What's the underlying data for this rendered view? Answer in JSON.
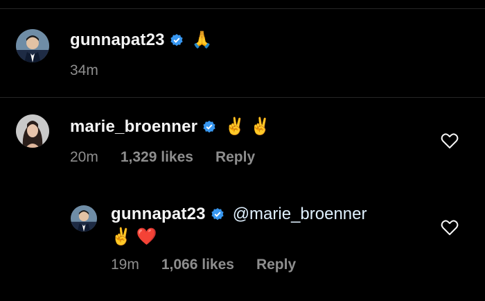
{
  "comments": [
    {
      "username": "gunnapat23",
      "verified": true,
      "emoji": "🙏",
      "time": "34m"
    },
    {
      "username": "marie_broenner",
      "verified": true,
      "emoji": "✌️ ✌️",
      "time": "20m",
      "likes": "1,329 likes",
      "reply_label": "Reply"
    },
    {
      "username": "gunnapat23",
      "verified": true,
      "mention": "@marie_broenner",
      "emoji": "✌️ ❤️",
      "time": "19m",
      "likes": "1,066 likes",
      "reply_label": "Reply"
    }
  ],
  "colors": {
    "background": "#000000",
    "text": "#f5f5f5",
    "secondary": "#8e8e8e",
    "verified": "#3897f0"
  }
}
